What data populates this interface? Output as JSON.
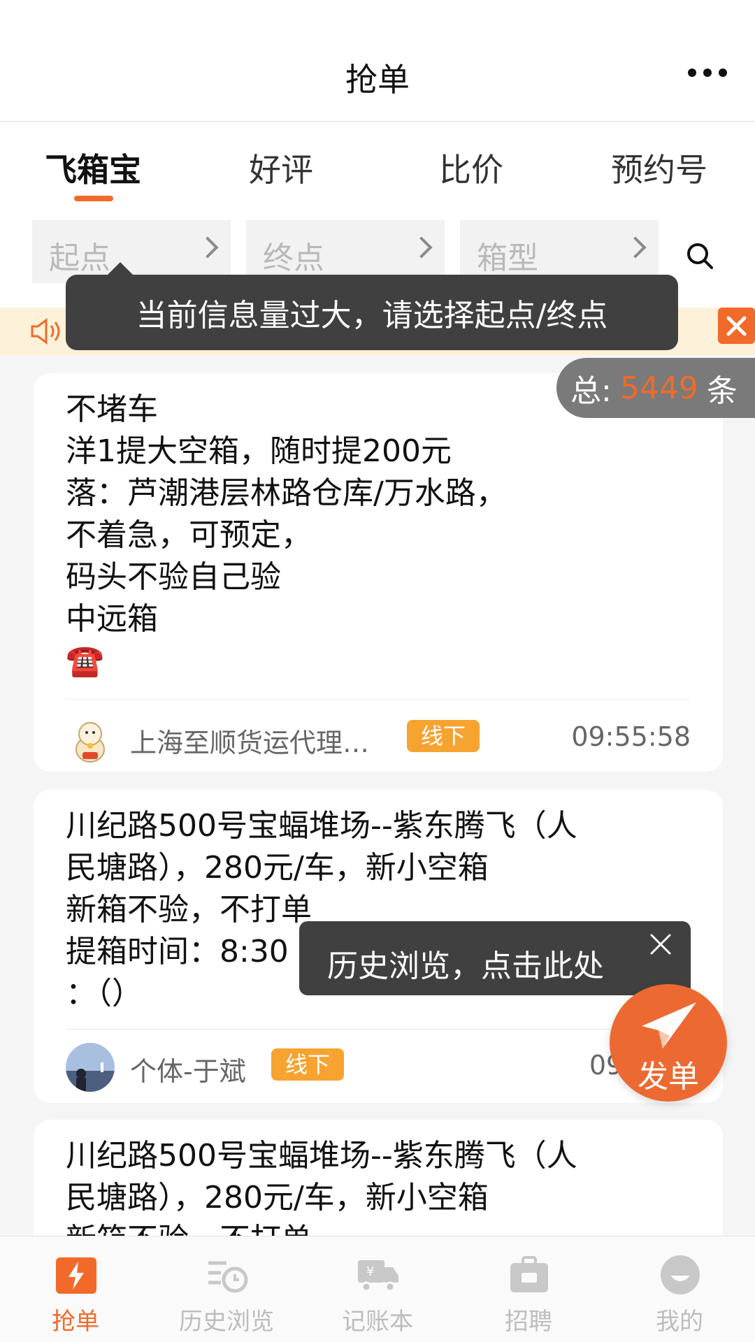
{
  "header": {
    "title": "抢单"
  },
  "tabs": [
    {
      "label": "飞箱宝",
      "active": true
    },
    {
      "label": "好评"
    },
    {
      "label": "比价"
    },
    {
      "label": "预约号"
    }
  ],
  "filters": [
    {
      "placeholder": "起点"
    },
    {
      "placeholder": "终点"
    },
    {
      "placeholder": "箱型"
    }
  ],
  "tooltip_top": "当前信息量过大，请选择起点/终点",
  "total": {
    "prefix": "总:",
    "count": "5449",
    "suffix": "条"
  },
  "cards": [
    {
      "lines": [
        "不堵车",
        "洋1提大空箱，随时提200元",
        "落：芦潮港层林路仓库/万水路，",
        "不着急，可预定，",
        "码头不验自己验",
        "中远箱",
        "☎️"
      ],
      "company": "上海至顺货运代理…",
      "badge": "线下",
      "time": "09:55:58"
    },
    {
      "lines": [
        "川纪路500号宝蝠堆场--紫东腾飞（人",
        "民塘路），280元/车，新小空箱",
        "新箱不验，不打单",
        "提箱时间：8:30",
        "：（）"
      ],
      "company": "个体-于斌",
      "badge": "线下",
      "time": "09:"
    },
    {
      "lines": [
        "川纪路500号宝蝠堆场--紫东腾飞（人",
        "民塘路），280元/车，新小空箱",
        "新箱不验，不打单"
      ]
    }
  ],
  "tooltip_history": "历史浏览，点击此处",
  "fab": {
    "label": "发单"
  },
  "bottom_nav": [
    {
      "label": "抢单",
      "icon": "grab-order-icon",
      "active": true
    },
    {
      "label": "历史浏览",
      "icon": "history-icon"
    },
    {
      "label": "记账本",
      "icon": "ledger-truck-icon"
    },
    {
      "label": "招聘",
      "icon": "recruit-briefcase-icon"
    },
    {
      "label": "我的",
      "icon": "profile-icon"
    }
  ],
  "colors": {
    "accent": "#f26a2a",
    "badge": "#f6a330",
    "tooltip": "#404040",
    "notice_bg": "#fdf2d9"
  }
}
